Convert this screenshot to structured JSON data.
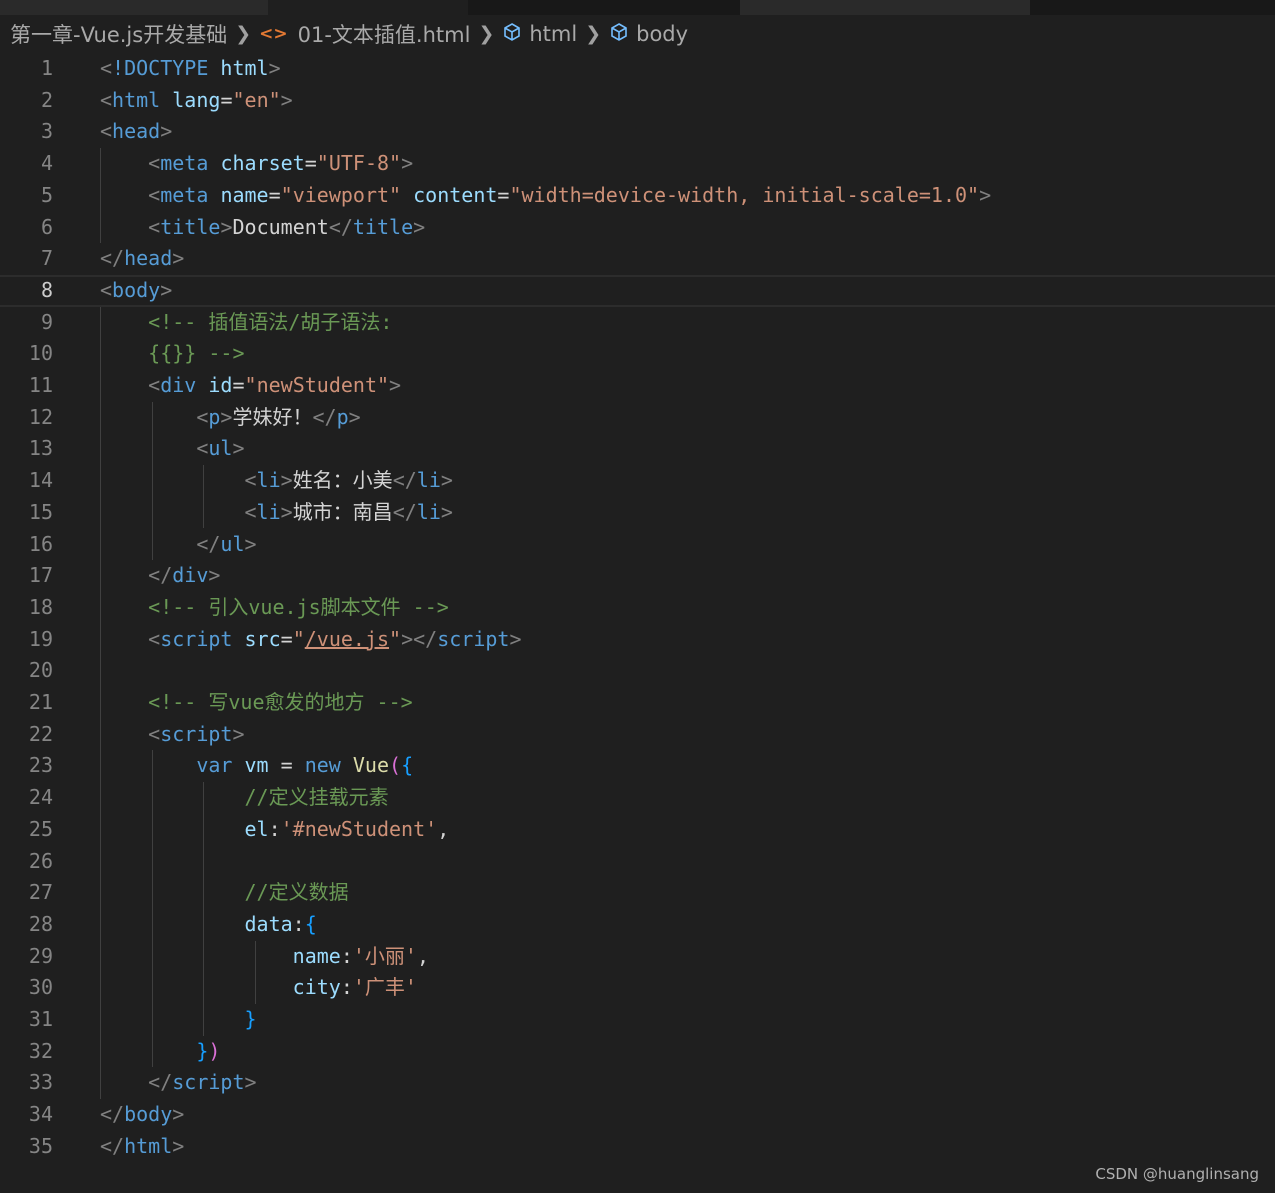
{
  "breadcrumb": {
    "folder": "第一章-Vue.js开发基础",
    "file": "01-文本插值.html",
    "node1": "html",
    "node2": "body",
    "file_icon": "code-file-icon",
    "node_icon": "symbol-cube-icon"
  },
  "editor": {
    "current_line": 8,
    "lines": [
      {
        "n": "1",
        "tokens": [
          [
            "punc",
            "<"
          ],
          [
            "tag",
            "!DOCTYPE"
          ],
          [
            "text",
            " "
          ],
          [
            "attr",
            "html"
          ],
          [
            "punc",
            ">"
          ]
        ]
      },
      {
        "n": "2",
        "tokens": [
          [
            "punc",
            "<"
          ],
          [
            "tag",
            "html"
          ],
          [
            "text",
            " "
          ],
          [
            "attr",
            "lang"
          ],
          [
            "text",
            "="
          ],
          [
            "str",
            "\"en\""
          ],
          [
            "punc",
            ">"
          ]
        ]
      },
      {
        "n": "3",
        "tokens": [
          [
            "punc",
            "<"
          ],
          [
            "tag",
            "head"
          ],
          [
            "punc",
            ">"
          ]
        ]
      },
      {
        "n": "4",
        "tokens": [
          [
            "text",
            "    "
          ],
          [
            "punc",
            "<"
          ],
          [
            "tag",
            "meta"
          ],
          [
            "text",
            " "
          ],
          [
            "attr",
            "charset"
          ],
          [
            "text",
            "="
          ],
          [
            "str",
            "\"UTF-8\""
          ],
          [
            "punc",
            ">"
          ]
        ]
      },
      {
        "n": "5",
        "tokens": [
          [
            "text",
            "    "
          ],
          [
            "punc",
            "<"
          ],
          [
            "tag",
            "meta"
          ],
          [
            "text",
            " "
          ],
          [
            "attr",
            "name"
          ],
          [
            "text",
            "="
          ],
          [
            "str",
            "\"viewport\""
          ],
          [
            "text",
            " "
          ],
          [
            "attr",
            "content"
          ],
          [
            "text",
            "="
          ],
          [
            "str",
            "\"width=device-width, initial-scale=1.0\""
          ],
          [
            "punc",
            ">"
          ]
        ]
      },
      {
        "n": "6",
        "tokens": [
          [
            "text",
            "    "
          ],
          [
            "punc",
            "<"
          ],
          [
            "tag",
            "title"
          ],
          [
            "punc",
            ">"
          ],
          [
            "text",
            "Document"
          ],
          [
            "punc",
            "</"
          ],
          [
            "tag",
            "title"
          ],
          [
            "punc",
            ">"
          ]
        ]
      },
      {
        "n": "7",
        "tokens": [
          [
            "punc",
            "</"
          ],
          [
            "tag",
            "head"
          ],
          [
            "punc",
            ">"
          ]
        ]
      },
      {
        "n": "8",
        "tokens": [
          [
            "punc",
            "<"
          ],
          [
            "tag",
            "body"
          ],
          [
            "punc",
            ">"
          ]
        ]
      },
      {
        "n": "9",
        "tokens": [
          [
            "text",
            "    "
          ],
          [
            "com",
            "<!-- 插值语法/胡子语法:"
          ]
        ]
      },
      {
        "n": "10",
        "tokens": [
          [
            "text",
            "    "
          ],
          [
            "com",
            "{{}} -->"
          ]
        ]
      },
      {
        "n": "11",
        "tokens": [
          [
            "text",
            "    "
          ],
          [
            "punc",
            "<"
          ],
          [
            "tag",
            "div"
          ],
          [
            "text",
            " "
          ],
          [
            "attr",
            "id"
          ],
          [
            "text",
            "="
          ],
          [
            "str",
            "\"newStudent\""
          ],
          [
            "punc",
            ">"
          ]
        ]
      },
      {
        "n": "12",
        "tokens": [
          [
            "text",
            "        "
          ],
          [
            "punc",
            "<"
          ],
          [
            "tag",
            "p"
          ],
          [
            "punc",
            ">"
          ],
          [
            "text",
            "学妹好！"
          ],
          [
            "punc",
            "</"
          ],
          [
            "tag",
            "p"
          ],
          [
            "punc",
            ">"
          ]
        ]
      },
      {
        "n": "13",
        "tokens": [
          [
            "text",
            "        "
          ],
          [
            "punc",
            "<"
          ],
          [
            "tag",
            "ul"
          ],
          [
            "punc",
            ">"
          ]
        ]
      },
      {
        "n": "14",
        "tokens": [
          [
            "text",
            "            "
          ],
          [
            "punc",
            "<"
          ],
          [
            "tag",
            "li"
          ],
          [
            "punc",
            ">"
          ],
          [
            "text",
            "姓名：小美"
          ],
          [
            "punc",
            "</"
          ],
          [
            "tag",
            "li"
          ],
          [
            "punc",
            ">"
          ]
        ]
      },
      {
        "n": "15",
        "tokens": [
          [
            "text",
            "            "
          ],
          [
            "punc",
            "<"
          ],
          [
            "tag",
            "li"
          ],
          [
            "punc",
            ">"
          ],
          [
            "text",
            "城市：南昌"
          ],
          [
            "punc",
            "</"
          ],
          [
            "tag",
            "li"
          ],
          [
            "punc",
            ">"
          ]
        ]
      },
      {
        "n": "16",
        "tokens": [
          [
            "text",
            "        "
          ],
          [
            "punc",
            "</"
          ],
          [
            "tag",
            "ul"
          ],
          [
            "punc",
            ">"
          ]
        ]
      },
      {
        "n": "17",
        "tokens": [
          [
            "text",
            "    "
          ],
          [
            "punc",
            "</"
          ],
          [
            "tag",
            "div"
          ],
          [
            "punc",
            ">"
          ]
        ]
      },
      {
        "n": "18",
        "tokens": [
          [
            "text",
            "    "
          ],
          [
            "com",
            "<!-- 引入vue.js脚本文件 -->"
          ]
        ]
      },
      {
        "n": "19",
        "tokens": [
          [
            "text",
            "    "
          ],
          [
            "punc",
            "<"
          ],
          [
            "tag",
            "script"
          ],
          [
            "text",
            " "
          ],
          [
            "attr",
            "src"
          ],
          [
            "text",
            "="
          ],
          [
            "str",
            "\""
          ],
          [
            "strlink",
            "/vue.js"
          ],
          [
            "str",
            "\""
          ],
          [
            "punc",
            "></"
          ],
          [
            "tag",
            "script"
          ],
          [
            "punc",
            ">"
          ]
        ]
      },
      {
        "n": "20",
        "tokens": []
      },
      {
        "n": "21",
        "tokens": [
          [
            "text",
            "    "
          ],
          [
            "com",
            "<!-- 写vue愈发的地方 -->"
          ]
        ]
      },
      {
        "n": "22",
        "tokens": [
          [
            "text",
            "    "
          ],
          [
            "punc",
            "<"
          ],
          [
            "tag",
            "script"
          ],
          [
            "punc",
            ">"
          ]
        ]
      },
      {
        "n": "23",
        "tokens": [
          [
            "text",
            "        "
          ],
          [
            "kw",
            "var"
          ],
          [
            "text",
            " "
          ],
          [
            "var",
            "vm"
          ],
          [
            "text",
            " = "
          ],
          [
            "kw",
            "new"
          ],
          [
            "text",
            " "
          ],
          [
            "fn",
            "Vue"
          ],
          [
            "b1",
            "("
          ],
          [
            "b2",
            "{"
          ]
        ]
      },
      {
        "n": "24",
        "tokens": [
          [
            "text",
            "            "
          ],
          [
            "com",
            "//定义挂载元素"
          ]
        ]
      },
      {
        "n": "25",
        "tokens": [
          [
            "text",
            "            "
          ],
          [
            "var",
            "el"
          ],
          [
            "text",
            ":"
          ],
          [
            "str",
            "'#newStudent'"
          ],
          [
            "text",
            ","
          ]
        ]
      },
      {
        "n": "26",
        "tokens": []
      },
      {
        "n": "27",
        "tokens": [
          [
            "text",
            "            "
          ],
          [
            "com",
            "//定义数据"
          ]
        ]
      },
      {
        "n": "28",
        "tokens": [
          [
            "text",
            "            "
          ],
          [
            "var",
            "data"
          ],
          [
            "text",
            ":"
          ],
          [
            "b2",
            "{"
          ]
        ]
      },
      {
        "n": "29",
        "tokens": [
          [
            "text",
            "                "
          ],
          [
            "var",
            "name"
          ],
          [
            "text",
            ":"
          ],
          [
            "str",
            "'小丽'"
          ],
          [
            "text",
            ","
          ]
        ]
      },
      {
        "n": "30",
        "tokens": [
          [
            "text",
            "                "
          ],
          [
            "var",
            "city"
          ],
          [
            "text",
            ":"
          ],
          [
            "str",
            "'广丰'"
          ]
        ]
      },
      {
        "n": "31",
        "tokens": [
          [
            "text",
            "            "
          ],
          [
            "b2",
            "}"
          ]
        ]
      },
      {
        "n": "32",
        "tokens": [
          [
            "text",
            "        "
          ],
          [
            "b2",
            "}"
          ],
          [
            "b1",
            ")"
          ]
        ]
      },
      {
        "n": "33",
        "tokens": [
          [
            "text",
            "    "
          ],
          [
            "punc",
            "</"
          ],
          [
            "tag",
            "script"
          ],
          [
            "punc",
            ">"
          ]
        ]
      },
      {
        "n": "34",
        "tokens": [
          [
            "punc",
            "</"
          ],
          [
            "tag",
            "body"
          ],
          [
            "punc",
            ">"
          ]
        ]
      },
      {
        "n": "35",
        "tokens": [
          [
            "punc",
            "</"
          ],
          [
            "tag",
            "html"
          ],
          [
            "punc",
            ">"
          ]
        ]
      }
    ]
  },
  "watermark": "CSDN @huanglinsang",
  "colors": {
    "background": "#1f1f1f",
    "tag": "#569cd6",
    "attribute": "#9cdcfe",
    "string": "#ce9178",
    "comment": "#6a9955",
    "function": "#dcdcaa",
    "bracket_1": "#da70d6",
    "bracket_2": "#179fff",
    "file_icon": "#e37933"
  }
}
